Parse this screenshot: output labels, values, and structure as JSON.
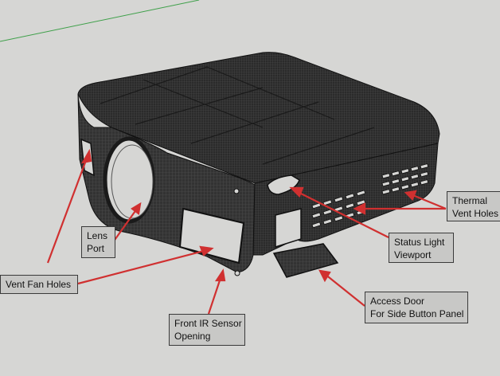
{
  "colors": {
    "background": "#d6d6d4",
    "model_fill": "#2e2e2e",
    "model_face_light": "#4a4a4a",
    "callout_fill": "#c8c8c6",
    "leader_line": "#d03030",
    "axis_green": "#3fa04a"
  },
  "labels": {
    "thermal": [
      "Thermal",
      "Vent Holes"
    ],
    "lens": [
      "Lens",
      "Port"
    ],
    "status": [
      "Status Light",
      "Viewport"
    ],
    "vent_fan": [
      "Vent Fan Holes"
    ],
    "access": [
      "Access Door",
      "For Side Button Panel"
    ],
    "ir": [
      "Front IR Sensor",
      "Opening"
    ]
  }
}
